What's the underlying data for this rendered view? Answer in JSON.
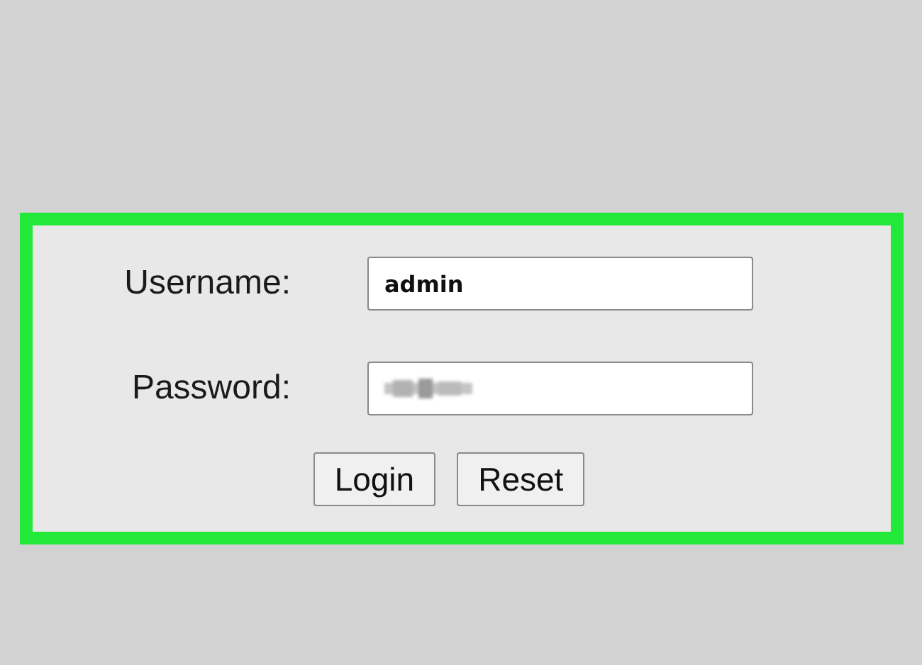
{
  "form": {
    "fields": [
      {
        "label": "Username:",
        "value": "admin",
        "kind": "text"
      },
      {
        "label": "Password:",
        "kind": "password"
      }
    ],
    "buttons": [
      "Login",
      "Reset"
    ]
  }
}
